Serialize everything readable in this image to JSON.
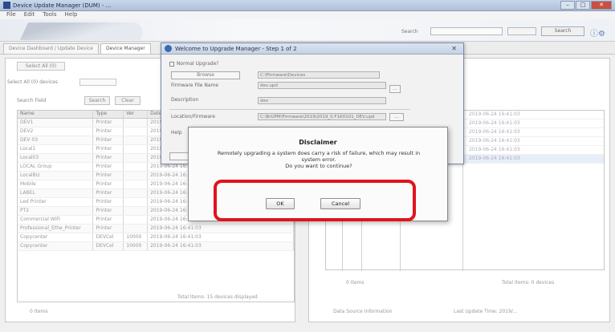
{
  "app": {
    "title": "Device Update Manager (DUM) - ...",
    "menu": [
      "File",
      "Edit",
      "Tools",
      "Help"
    ]
  },
  "banner": {
    "search_label": "Search",
    "search_button_label": "Search",
    "colors": {
      "accent": "#3a6ab0"
    }
  },
  "tabs": [
    {
      "label": "Device Dashboard / Update Device"
    },
    {
      "label": "Device Manager"
    }
  ],
  "left_panel": {
    "button_label": "Select All (0)",
    "field_label": "Select All (0) devices",
    "filter_label": "Search Field",
    "filter_buttons": [
      "Search",
      "Clear"
    ],
    "columns": [
      "Name",
      "Type",
      "Ver",
      "Date"
    ],
    "rows": [
      [
        "DEV1",
        "Printer",
        "",
        "2019-06-24 16:41:03"
      ],
      [
        "DEV2",
        "Printer",
        "",
        "2019-06-24 16:41:03"
      ],
      [
        "DEV 03",
        "Printer",
        "",
        "2019-06-24 16:41:03"
      ],
      [
        "Local1",
        "Printer",
        "",
        "2019-06-24 16:41:03"
      ],
      [
        "Local03",
        "Printer",
        "",
        "2019-06-24 16:41:03"
      ],
      [
        "LOCAL Group",
        "Printer",
        "",
        "2019-06-24 16:41:03"
      ],
      [
        "LocalBiz",
        "Printer",
        "",
        "2019-06-24 16:41:03"
      ],
      [
        "Mobile",
        "Printer",
        "",
        "2019-06-24 16:41:03"
      ],
      [
        "LABEL",
        "Printer",
        "",
        "2019-06-24 16:41:03"
      ],
      [
        "Led Printer",
        "Printer",
        "",
        "2019-06-24 16:41:03"
      ],
      [
        "PT2",
        "Printer",
        "",
        "2019-06-24 16:41:03"
      ],
      [
        "Commercial WiFi",
        "Printer",
        "",
        "2019-06-24 16:41:03"
      ],
      [
        "Professional_Ethe_Printer",
        "Printer",
        "",
        "2019-06-24 16:41:03"
      ],
      [
        "Copycenter",
        "DEVCel",
        "10000",
        "2019-06-24 16:41:03"
      ],
      [
        "Copycenter",
        "DEVCel",
        "10000",
        "2019-06-24 16:41:03"
      ]
    ],
    "footer_left": "0 Items",
    "footer_right": "Total Items: 15 devices displayed"
  },
  "right_panel": {
    "rows": [
      "2019-06-24 16:41:03",
      "2019-06-24 16:41:03",
      "2019-06-24 16:41:03",
      "2019-06-24 16:41:03",
      "2019-06-24 16:41:03",
      "2019-06-24 16:41:03"
    ],
    "footer_left": "0 Items",
    "footer_right": "Total Items: 0 devices",
    "bottom_left": "Data Source Information",
    "bottom_right": "Last Update Time: 2019/..."
  },
  "wizard": {
    "title": "Welcome to Upgrade Manager - Step 1 of 2",
    "checkbox_label": "Normal Upgrade?",
    "browse_label": "Browse",
    "path_value": "C:\\Firmware\\Devices",
    "firmware_label": "Firmware File Name",
    "firmware_value": "dev.upd",
    "description_label": "Description",
    "description_value": "dev",
    "location_label": "Location/Firmware",
    "location_value": "C:\\BrUPM\\Firmware\\2019\\2019_0.F1K0101_DEV.upd",
    "help_label": "Help",
    "ellipsis": "...",
    "close_glyph": "✕"
  },
  "disclaimer": {
    "title": "Disclaimer",
    "message_line1": "Remotely upgrading a system does carry a risk of failure, which may result in",
    "message_line2": "system error.",
    "message_line3": "Do you want to continue?",
    "ok_label": "OK",
    "cancel_label": "Cancel"
  }
}
